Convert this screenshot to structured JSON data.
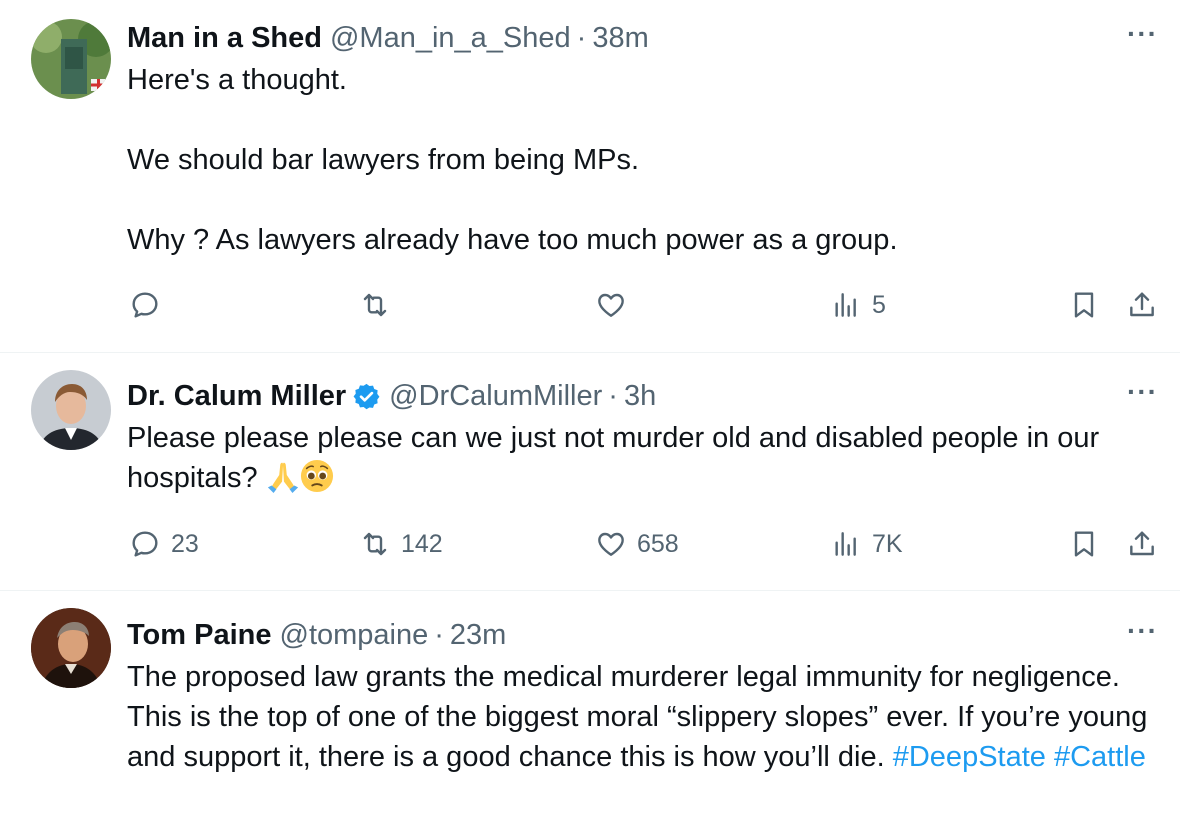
{
  "tweets": [
    {
      "name": "Man in a Shed",
      "handle": "@Man_in_a_Shed",
      "dot": "·",
      "time": "38m",
      "more": "···",
      "text": "Here's a thought.\n\nWe should bar lawyers from being MPs.\n\nWhy ? As lawyers already have too much power as a group.",
      "replies": "",
      "retweets": "",
      "likes": "",
      "views": "5"
    },
    {
      "name": "Dr. Calum Miller",
      "handle": "@DrCalumMiller",
      "dot": "·",
      "time": "3h",
      "more": "···",
      "text": "Please please please can we just not murder old and disabled people in our hospitals? ",
      "replies": "23",
      "retweets": "142",
      "likes": "658",
      "views": "7K"
    },
    {
      "name": "Tom Paine",
      "handle": "@tompaine",
      "dot": "·",
      "time": "23m",
      "more": "···",
      "text": "The proposed law grants the medical murderer legal immunity for negligence. This is the top of one of the biggest moral “slippery slopes” ever. If you’re young and support it, there is a good chance this is how you’ll die. ",
      "hashtags": [
        "#DeepState",
        "#Cattle"
      ]
    }
  ],
  "colors": {
    "text": "#0f1419",
    "muted": "#536471",
    "accent": "#1d9bf0",
    "divider": "#eff3f4"
  },
  "icons": [
    "reply-icon",
    "retweet-icon",
    "like-icon",
    "views-icon",
    "bookmark-icon",
    "share-icon",
    "verified-icon",
    "more-icon"
  ]
}
